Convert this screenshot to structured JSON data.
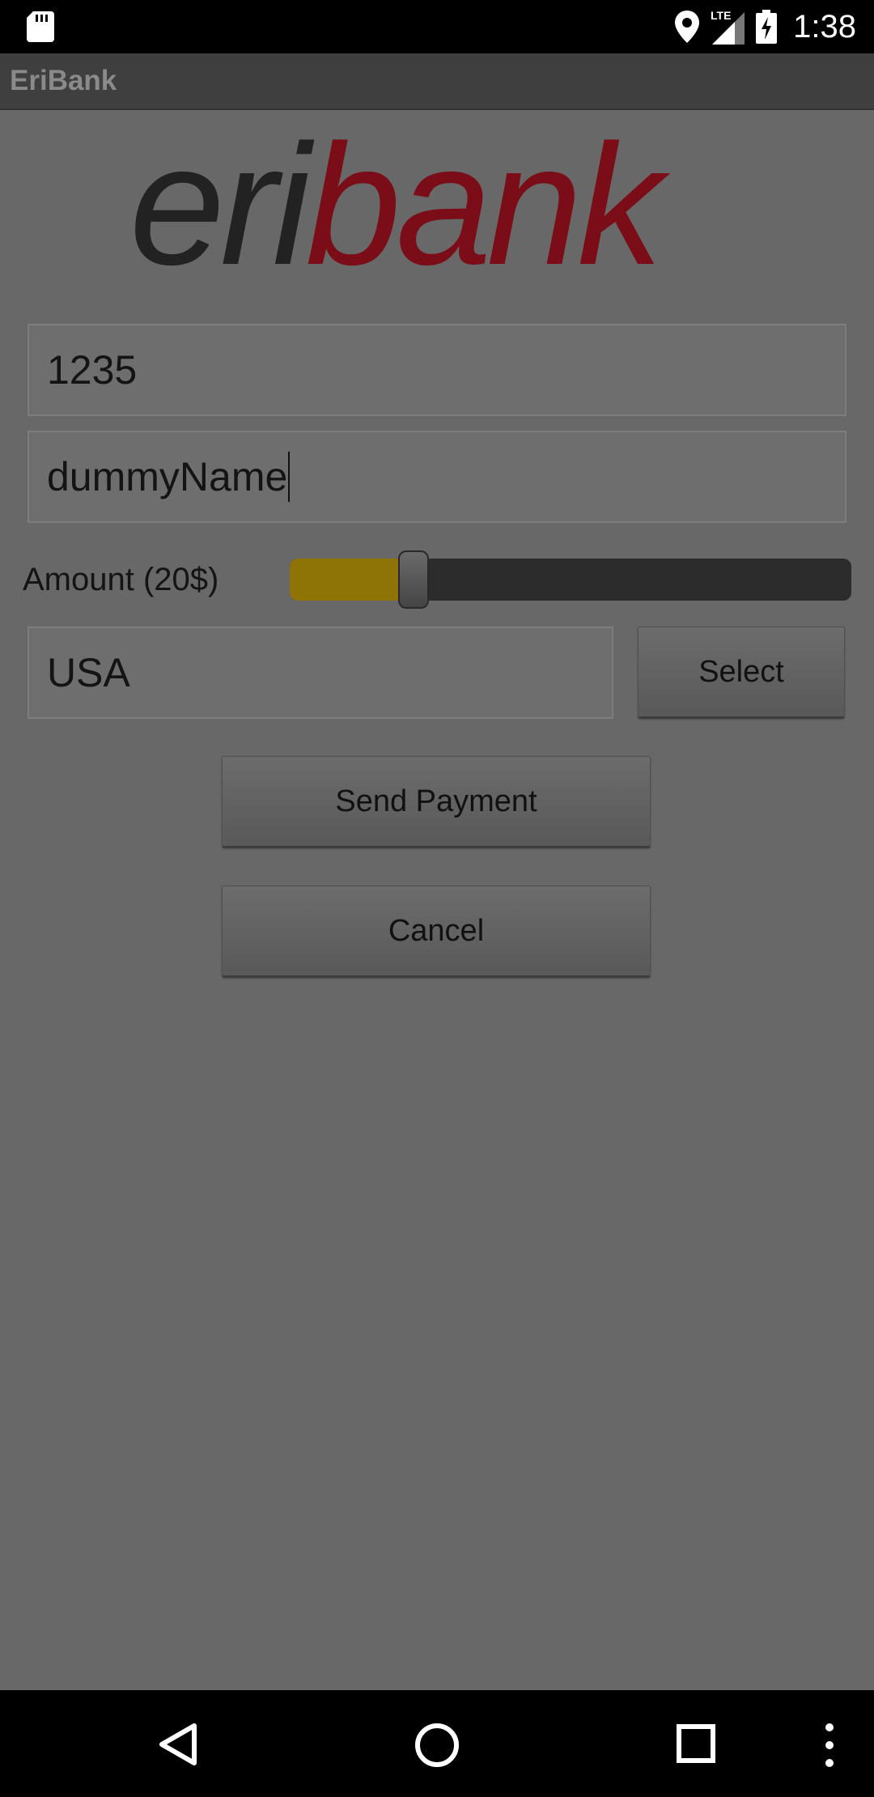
{
  "status_bar": {
    "time": "1:38",
    "network_label": "LTE",
    "icons": [
      "sd-card-icon",
      "location-icon",
      "lte-signal-icon",
      "battery-charging-icon"
    ]
  },
  "app": {
    "title": "EriBank",
    "logo": {
      "part1": "eri",
      "part2": "bank",
      "colors": {
        "part1": "#222222",
        "part2": "#7a0d17"
      }
    }
  },
  "form": {
    "phone_value": "1235",
    "name_value": "dummyName",
    "amount_label": "Amount (20$)",
    "amount_fraction": 0.22,
    "country_value": "USA",
    "select_label": "Select"
  },
  "actions": {
    "send_label": "Send Payment",
    "cancel_label": "Cancel"
  },
  "nav": {
    "icons": [
      "back-icon",
      "home-icon",
      "recents-icon",
      "overflow-menu-icon"
    ]
  },
  "colors": {
    "content_bg": "#686868",
    "slider_fill": "#8e7407",
    "app_bar": "#3f3f3f"
  }
}
